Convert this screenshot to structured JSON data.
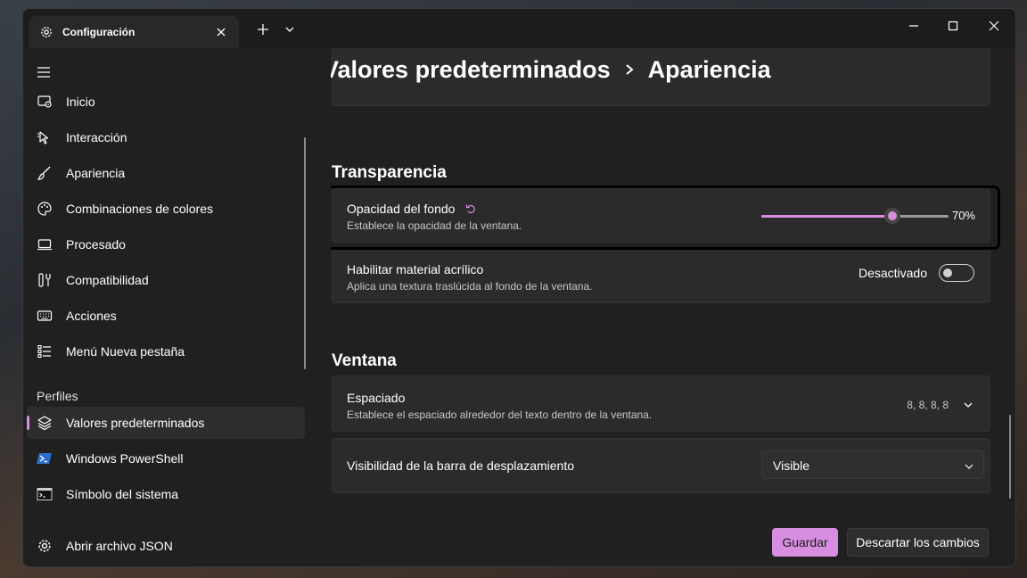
{
  "window": {
    "tab_title": "Configuración",
    "tab_icon": "gear-icon"
  },
  "sidebar": {
    "items": [
      {
        "label": "Inicio",
        "icon": "home-icon"
      },
      {
        "label": "Interacción",
        "icon": "cursor-icon"
      },
      {
        "label": "Apariencia",
        "icon": "brush-icon"
      },
      {
        "label": "Combinaciones de colores",
        "icon": "palette-icon"
      },
      {
        "label": "Procesado",
        "icon": "monitor-icon"
      },
      {
        "label": "Compatibilidad",
        "icon": "wrench-icon"
      },
      {
        "label": "Acciones",
        "icon": "keyboard-icon"
      },
      {
        "label": "Menú Nueva pestaña",
        "icon": "list-icon"
      }
    ],
    "profiles_header": "Perfiles",
    "profiles": [
      {
        "label": "Valores predeterminados",
        "icon": "layers-icon",
        "selected": true
      },
      {
        "label": "Windows PowerShell",
        "icon": "powershell-icon"
      },
      {
        "label": "Símbolo del sistema",
        "icon": "cmd-icon"
      }
    ],
    "open_json": "Abrir archivo JSON"
  },
  "breadcrumb": {
    "parent": "Valores predeterminados",
    "current": "Apariencia"
  },
  "main": {
    "transparency_header": "Transparencia",
    "opacity": {
      "title": "Opacidad del fondo",
      "description": "Establece la opacidad de la ventana.",
      "value": 70,
      "value_label": "70%"
    },
    "acrylic": {
      "title": "Habilitar material acrílico",
      "description": "Aplica una textura traslúcida al fondo de la ventana.",
      "state_label": "Desactivado"
    },
    "window_header": "Ventana",
    "padding": {
      "title": "Espaciado",
      "description": "Establece el espaciado alrededor del texto dentro de la ventana.",
      "value": "8, 8, 8, 8"
    },
    "scrollbar": {
      "title": "Visibilidad de la barra de desplazamiento",
      "value": "Visible"
    }
  },
  "footer": {
    "save": "Guardar",
    "discard": "Descartar los cambios"
  },
  "colors": {
    "accent": "#d88ee0",
    "background": "#202020",
    "card": "#2b2b2b"
  }
}
